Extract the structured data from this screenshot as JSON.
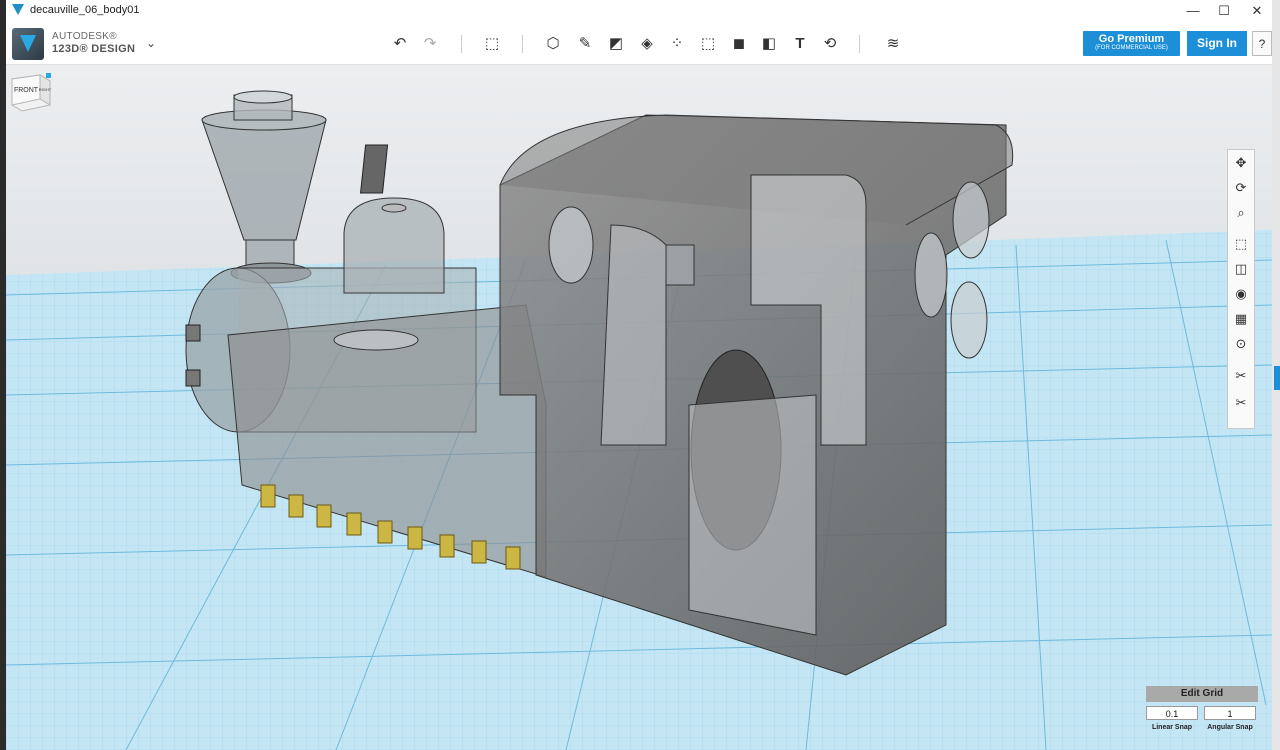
{
  "window": {
    "title": "decauville_06_body01",
    "controls": {
      "minimize": "—",
      "maximize": "☐",
      "close": "✕"
    }
  },
  "app": {
    "brand_line1": "AUTODESK®",
    "brand_line2": "123D® DESIGN",
    "menu_chevron": "⌄"
  },
  "toolbar": {
    "undo": "↶",
    "redo": "↷",
    "transform": "⬚",
    "primitives": "⬡",
    "sketch": "✎",
    "construct": "◩",
    "modify": "◈",
    "pattern": "⁘",
    "grouping": "⬚",
    "combine": "◼",
    "measure": "◧",
    "text": "T",
    "snap": "⟲",
    "material": "≋"
  },
  "account": {
    "premium_label": "Go Premium",
    "premium_sub": "(FOR COMMERCIAL USE)",
    "signin_label": "Sign In",
    "help_label": "?"
  },
  "viewcube": {
    "front_label": "FRONT",
    "right_label": "RIGHT"
  },
  "nav": {
    "pan": "✥",
    "orbit": "⟳",
    "zoom": "⌕",
    "fit": "⬚",
    "views": "◫",
    "visibility": "◉",
    "materials": "▦",
    "screenshot": "⊙",
    "snap_tool": "✂",
    "measure_tool": "✂"
  },
  "grid": {
    "title": "Edit Grid",
    "linear_value": "0.1",
    "angular_value": "1",
    "linear_label": "Linear Snap",
    "angular_label": "Angular Snap"
  },
  "colors": {
    "accent": "#1c8fd8",
    "grid_bg": "#bfe3f2",
    "model": "#6e6e6e",
    "pins": "#c9b13a"
  }
}
